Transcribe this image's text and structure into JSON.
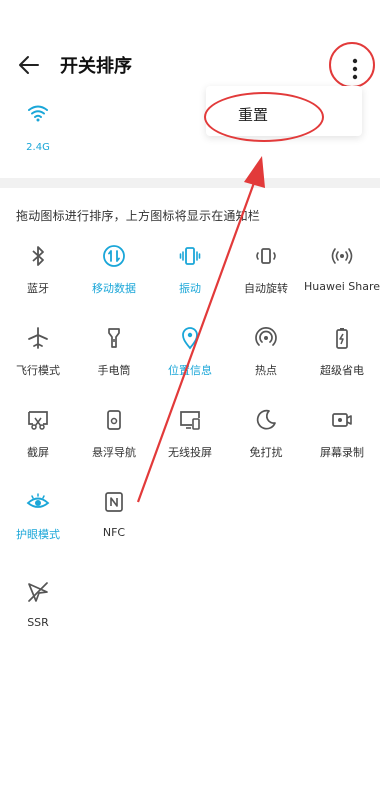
{
  "header": {
    "title": "开关排序"
  },
  "menu": {
    "reset_label": "重置"
  },
  "top_tile": {
    "label": "2.4G",
    "icon": "wifi-icon"
  },
  "hint": "拖动图标进行排序，上方图标将显示在通知栏",
  "tiles": [
    {
      "label": "蓝牙",
      "icon": "bluetooth-icon",
      "active": false
    },
    {
      "label": "移动数据",
      "icon": "mobile-data-icon",
      "active": true
    },
    {
      "label": "振动",
      "icon": "vibrate-icon",
      "active": true
    },
    {
      "label": "自动旋转",
      "icon": "auto-rotate-icon",
      "active": false
    },
    {
      "label": "Huawei Share",
      "icon": "huawei-share-icon",
      "active": false
    },
    {
      "label": "飞行模式",
      "icon": "airplane-icon",
      "active": false
    },
    {
      "label": "手电筒",
      "icon": "flashlight-icon",
      "active": false
    },
    {
      "label": "位置信息",
      "icon": "location-icon",
      "active": true
    },
    {
      "label": "热点",
      "icon": "hotspot-icon",
      "active": false
    },
    {
      "label": "超级省电",
      "icon": "battery-saver-icon",
      "active": false
    },
    {
      "label": "截屏",
      "icon": "screenshot-icon",
      "active": false
    },
    {
      "label": "悬浮导航",
      "icon": "floating-nav-icon",
      "active": false
    },
    {
      "label": "无线投屏",
      "icon": "wireless-projection-icon",
      "active": false
    },
    {
      "label": "免打扰",
      "icon": "do-not-disturb-icon",
      "active": false
    },
    {
      "label": "屏幕录制",
      "icon": "screen-record-icon",
      "active": false
    },
    {
      "label": "护眼模式",
      "icon": "eye-comfort-icon",
      "active": true
    },
    {
      "label": "NFC",
      "icon": "nfc-icon",
      "active": false
    },
    {
      "label": "SSR",
      "icon": "ssr-icon",
      "active": false
    }
  ],
  "colors": {
    "accent": "#1aa6d8",
    "annotation": "#e23a3a",
    "icon_inactive": "#555555"
  }
}
